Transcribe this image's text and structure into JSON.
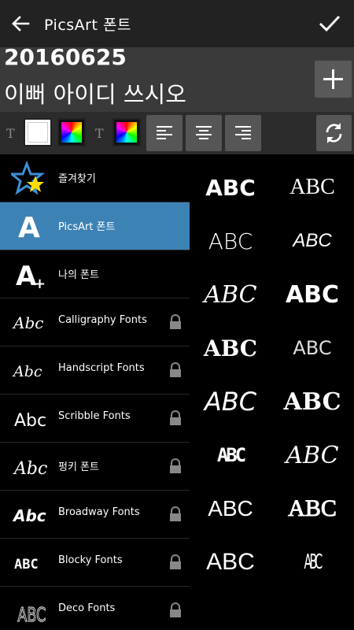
{
  "header": {
    "title": "PicsArt 폰트"
  },
  "editor": {
    "line1": "20160625",
    "line2": "이뻐 아이디 쓰시오"
  },
  "toolbar": {
    "text_icon": "T",
    "text_icon2": "T"
  },
  "categories": [
    {
      "label": "즐겨찾기",
      "icon": "star-icon",
      "locked": false
    },
    {
      "label": "PicsArt 폰트",
      "icon": "picsart-font-icon",
      "locked": false
    },
    {
      "label": "나의 폰트",
      "icon": "my-font-icon",
      "locked": false
    },
    {
      "label": "Calligraphy Fonts",
      "icon": "calligraphy-icon",
      "locked": true
    },
    {
      "label": "Handscript Fonts",
      "icon": "handscript-icon",
      "locked": true
    },
    {
      "label": "Scribble Fonts",
      "icon": "scribble-icon",
      "locked": true
    },
    {
      "label": "펑키 폰트",
      "icon": "funky-icon",
      "locked": true
    },
    {
      "label": "Broadway Fonts",
      "icon": "broadway-icon",
      "locked": true
    },
    {
      "label": "Blocky Fonts",
      "icon": "blocky-icon",
      "locked": true
    },
    {
      "label": "Deco Fonts",
      "icon": "deco-icon",
      "locked": true
    }
  ],
  "samples": [
    "ABC",
    "ABC",
    "ABC",
    "ABC",
    "ABC",
    "ABC",
    "ABC",
    "ABC",
    "ABC",
    "ABC",
    "ABC",
    "ABC",
    "ABC",
    "ABC",
    "ABC",
    "ABC"
  ],
  "colors": {
    "topbar": "#222222",
    "active": "#3d82b5",
    "button": "#565656"
  }
}
